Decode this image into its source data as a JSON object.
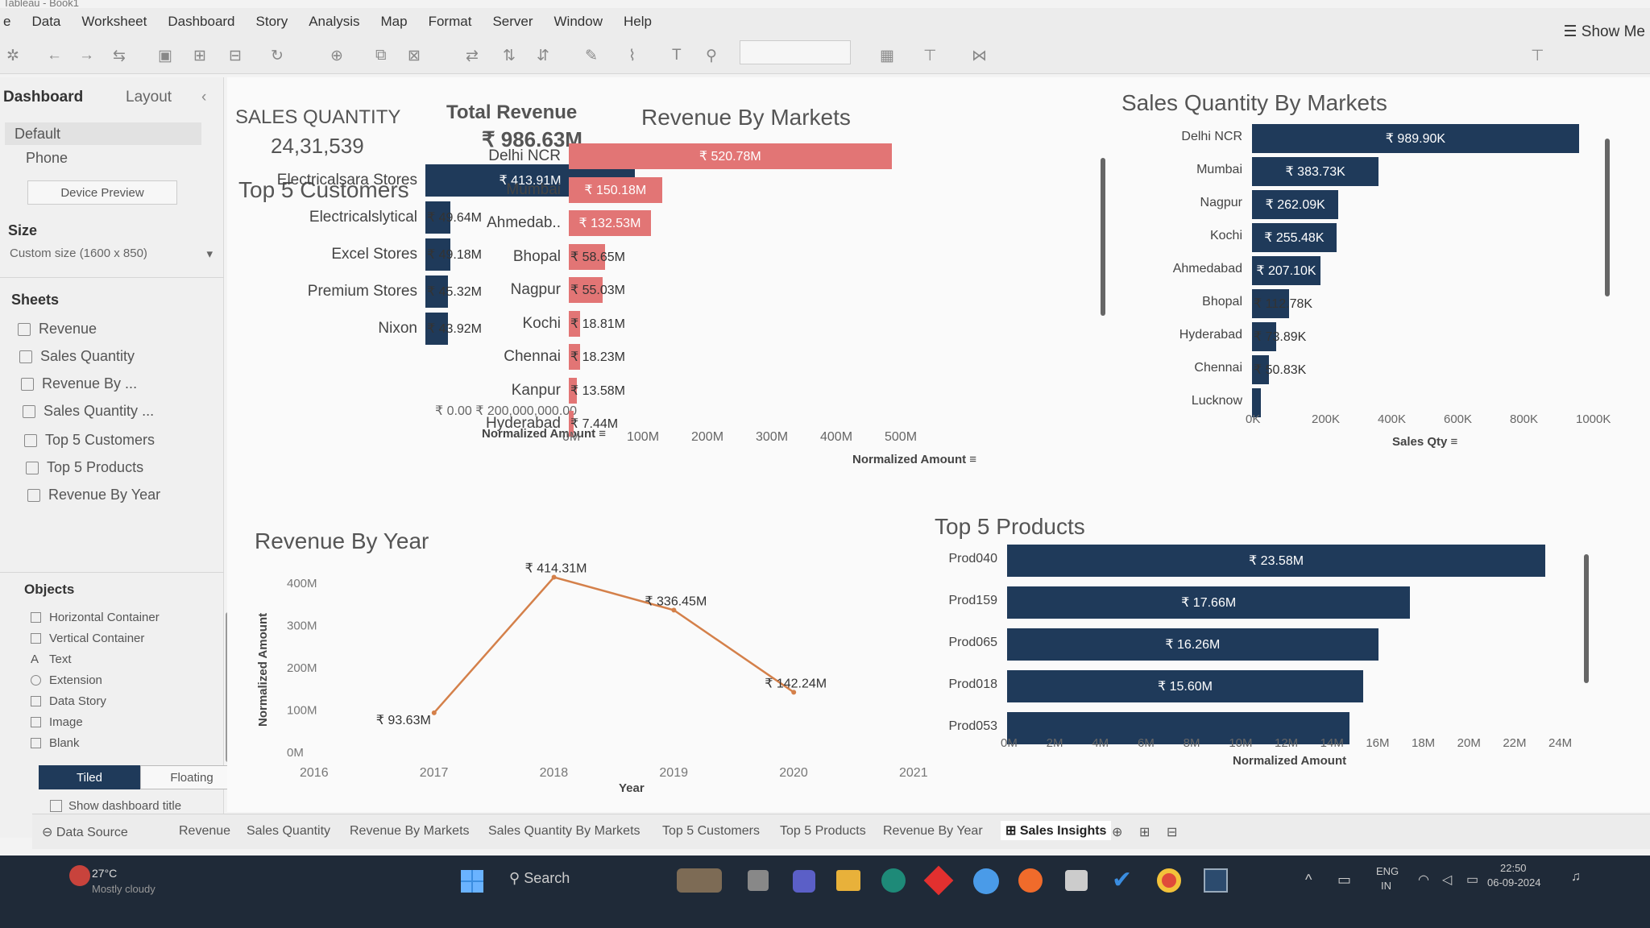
{
  "app": {
    "title": "Tableau - Book1"
  },
  "menu": [
    "e",
    "Data",
    "Worksheet",
    "Dashboard",
    "Story",
    "Analysis",
    "Map",
    "Format",
    "Server",
    "Window",
    "Help"
  ],
  "toolbar": {
    "show_me": "Show Me"
  },
  "left_panel": {
    "tab_dashboard": "Dashboard",
    "tab_layout": "Layout",
    "collapse_icon": "chevron-left-icon",
    "device_default": "Default",
    "device_phone": "Phone",
    "device_preview": "Device Preview",
    "size_label": "Size",
    "size_value": "Custom size (1600 x 850)",
    "sheets_label": "Sheets",
    "sheets": [
      "Revenue",
      "Sales Quantity",
      "Revenue By ...",
      "Sales Quantity ...",
      "Top 5 Customers",
      "Top 5 Products",
      "Revenue By Year"
    ],
    "objects_label": "Objects",
    "objects": [
      "Horizontal Container",
      "Vertical Container",
      "Text",
      "Extension",
      "Data Story",
      "Image",
      "Blank"
    ],
    "tiled": "Tiled",
    "floating": "Floating",
    "show_title": "Show dashboard title"
  },
  "kpis": {
    "sales_qty_label": "SALES QUANTITY",
    "sales_qty_value": "24,31,539",
    "revenue_label": "Total Revenue",
    "revenue_value": "₹ 986.63M"
  },
  "top_customers": {
    "title": "Top 5 Customers",
    "axis_ticks": "₹ 0.00 ₹ 200,000,000.00",
    "axis_title": "Normalized Amount",
    "chart_data": {
      "type": "bar",
      "orientation": "horizontal",
      "categories": [
        "Electricalsara Stores",
        "Electricalslytical",
        "Excel Stores",
        "Premium Stores",
        "Nixon"
      ],
      "values": [
        413.91,
        49.64,
        49.18,
        45.32,
        43.92
      ],
      "labels": [
        "₹ 413.91M",
        "₹ 49.64M",
        "₹ 49.18M",
        "₹ 45.32M",
        "₹ 43.92M"
      ],
      "unit": "M"
    }
  },
  "revenue_markets": {
    "title": "Revenue By Markets",
    "axis_title": "Normalized Amount",
    "chart_data": {
      "type": "bar",
      "orientation": "horizontal",
      "categories": [
        "Delhi NCR",
        "Mumbai",
        "Ahmedab..",
        "Bhopal",
        "Nagpur",
        "Kochi",
        "Chennai",
        "Kanpur",
        "Hyderabad"
      ],
      "values": [
        520.78,
        150.18,
        132.53,
        58.65,
        55.03,
        18.81,
        18.23,
        13.58,
        7.44
      ],
      "labels": [
        "₹ 520.78M",
        "₹ 150.18M",
        "₹ 132.53M",
        "₹ 58.65M",
        "₹ 55.03M",
        "₹ 18.81M",
        "₹ 18.23M",
        "₹ 13.58M",
        "₹ 7.44M"
      ],
      "ticks": [
        "0M",
        "100M",
        "200M",
        "300M",
        "400M",
        "500M"
      ],
      "xlim": [
        0,
        520
      ]
    }
  },
  "sales_qty_markets": {
    "title": "Sales Quantity By Markets",
    "axis_title": "Sales Qty",
    "chart_data": {
      "type": "bar",
      "orientation": "horizontal",
      "categories": [
        "Delhi NCR",
        "Mumbai",
        "Nagpur",
        "Kochi",
        "Ahmedabad",
        "Bhopal",
        "Hyderabad",
        "Chennai",
        "Lucknow"
      ],
      "values": [
        989.9,
        383.73,
        262.09,
        255.48,
        207.1,
        112.78,
        73.89,
        50.83,
        27
      ],
      "labels": [
        "₹ 989.90K",
        "₹ 383.73K",
        "₹ 262.09K",
        "₹ 255.48K",
        "₹ 207.10K",
        "₹ 112.78K",
        "₹ 73.89K",
        "₹ 50.83K",
        ""
      ],
      "ticks": [
        "0K",
        "200K",
        "400K",
        "600K",
        "800K",
        "1000K"
      ],
      "xlim": [
        0,
        1000
      ]
    }
  },
  "revenue_year": {
    "title": "Revenue By Year",
    "x_title": "Year",
    "y_title": "Normalized Amount",
    "chart_data": {
      "type": "line",
      "x": [
        "2017",
        "2018",
        "2019",
        "2020"
      ],
      "values": [
        93.63,
        414.31,
        336.45,
        142.24
      ],
      "labels": [
        "₹ 93.63M",
        "₹ 414.31M",
        "₹ 336.45M",
        "₹ 142.24M"
      ],
      "x_ticks": [
        "2016",
        "2017",
        "2018",
        "2019",
        "2020",
        "2021"
      ],
      "y_ticks": [
        "0M",
        "100M",
        "200M",
        "300M",
        "400M"
      ],
      "ylim": [
        0,
        400
      ],
      "color": "#d4804a"
    }
  },
  "top_products": {
    "title": "Top 5 Products",
    "axis_title": "Normalized Amount",
    "chart_data": {
      "type": "bar",
      "orientation": "horizontal",
      "categories": [
        "Prod040",
        "Prod159",
        "Prod065",
        "Prod018",
        "Prod053"
      ],
      "values": [
        23.58,
        17.66,
        16.26,
        15.6,
        15.0
      ],
      "labels": [
        "₹ 23.58M",
        "₹ 17.66M",
        "₹ 16.26M",
        "₹ 15.60M",
        ""
      ],
      "ticks": [
        "0M",
        "2M",
        "4M",
        "6M",
        "8M",
        "10M",
        "12M",
        "14M",
        "16M",
        "18M",
        "20M",
        "22M",
        "24M"
      ],
      "xlim": [
        0,
        24
      ]
    }
  },
  "sheet_tabs": [
    "Data Source",
    "Revenue",
    "Sales Quantity",
    "Revenue By Markets",
    "Sales Quantity By Markets",
    "Top 5 Customers",
    "Top 5 Products",
    "Revenue By Year",
    "Sales Insights"
  ],
  "taskbar": {
    "weather_temp": "27°C",
    "weather_desc": "Mostly cloudy",
    "search": "Search",
    "lang1": "ENG",
    "lang2": "IN",
    "time": "22:50",
    "date": "06-09-2024"
  },
  "colors": {
    "dark_bar": "#1f3a5a",
    "pink_bar": "#e27575",
    "line": "#d4804a"
  }
}
